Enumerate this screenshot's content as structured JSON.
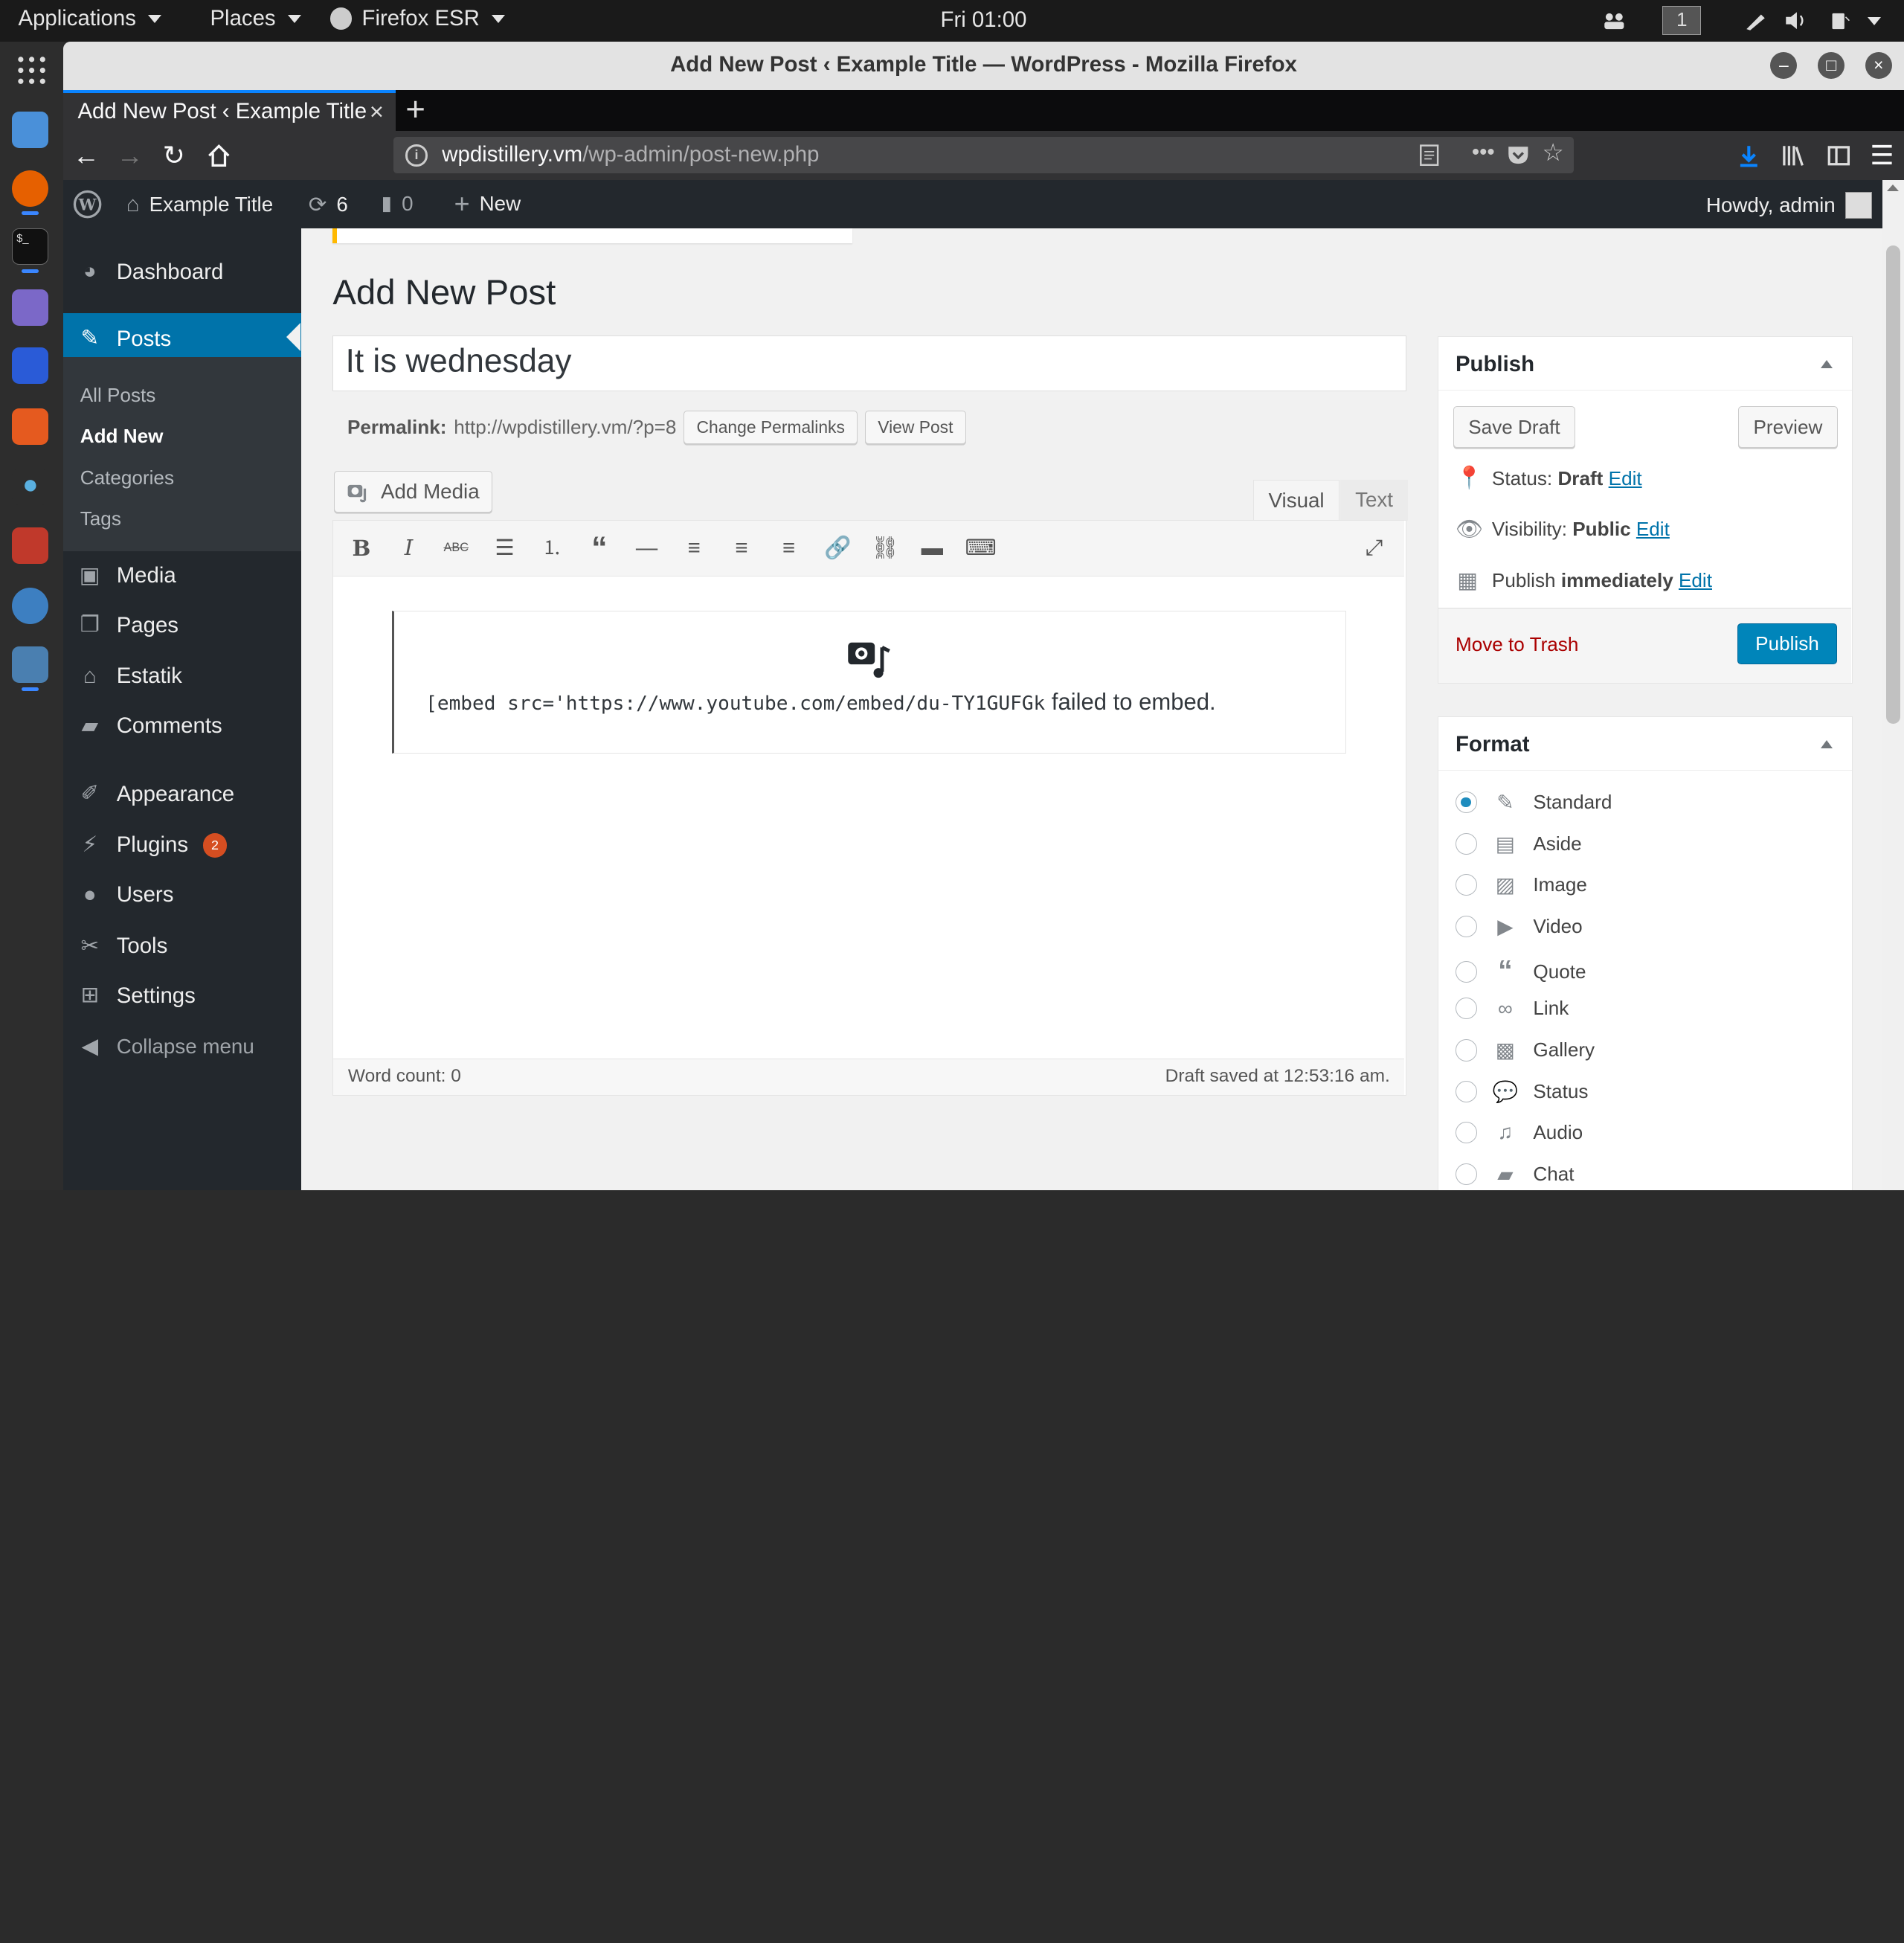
{
  "system": {
    "menus": [
      "Applications",
      "Places",
      "Firefox ESR"
    ],
    "clock": "Fri 01:00",
    "workspace": "1"
  },
  "window": {
    "title": "Add New Post ‹ Example Title — WordPress - Mozilla Firefox"
  },
  "browser": {
    "tab_title": "Add New Post ‹ Example Title",
    "url_host": "wpdistillery.vm",
    "url_path": "/wp-admin/post-new.php"
  },
  "adminbar": {
    "site_name": "Example Title",
    "updates_count": "6",
    "comments_count": "0",
    "new_label": "New",
    "howdy": "Howdy, admin"
  },
  "sidebar": {
    "items": [
      {
        "label": "Dashboard",
        "icon": "dashboard-icon"
      },
      {
        "label": "Posts",
        "icon": "pin-icon"
      },
      {
        "label": "Media",
        "icon": "media-icon"
      },
      {
        "label": "Pages",
        "icon": "pages-icon"
      },
      {
        "label": "Estatik",
        "icon": "home-icon"
      },
      {
        "label": "Comments",
        "icon": "comment-icon"
      },
      {
        "label": "Appearance",
        "icon": "brush-icon"
      },
      {
        "label": "Plugins",
        "icon": "plug-icon"
      },
      {
        "label": "Users",
        "icon": "users-icon"
      },
      {
        "label": "Tools",
        "icon": "wrench-icon"
      },
      {
        "label": "Settings",
        "icon": "settings-icon"
      }
    ],
    "plugins_badge": "2",
    "submenu": [
      "All Posts",
      "Add New",
      "Categories",
      "Tags"
    ],
    "collapse": "Collapse menu"
  },
  "editor": {
    "page_title": "Add New Post",
    "post_title": "It is wednesday",
    "permalink_label": "Permalink:",
    "permalink_url": "http://wpdistillery.vm/?p=8",
    "change_permalinks": "Change Permalinks",
    "view_post": "View Post",
    "add_media": "Add Media",
    "tab_visual": "Visual",
    "tab_text": "Text",
    "embed_code": "[embed src='https://www.youtube.com/embed/du-TY1GUFGk",
    "embed_failed": " failed to embed.",
    "word_count": "Word count: 0",
    "draft_saved": "Draft saved at 12:53:16 am."
  },
  "publish": {
    "title": "Publish",
    "save_draft": "Save Draft",
    "preview": "Preview",
    "status_label": "Status:",
    "status_value": "Draft",
    "visibility_label": "Visibility:",
    "visibility_value": "Public",
    "publish_label": "Publish",
    "publish_value": "immediately",
    "edit": "Edit",
    "move_to_trash": "Move to Trash",
    "publish_button": "Publish"
  },
  "format": {
    "title": "Format",
    "selected": "Standard",
    "options": [
      "Standard",
      "Aside",
      "Image",
      "Video",
      "Quote",
      "Link",
      "Gallery",
      "Status",
      "Audio",
      "Chat"
    ]
  },
  "colors": {
    "accent": "#0073aa",
    "admin_dark": "#23282d",
    "publish_button": "#0085ba",
    "trash": "#a00000"
  }
}
